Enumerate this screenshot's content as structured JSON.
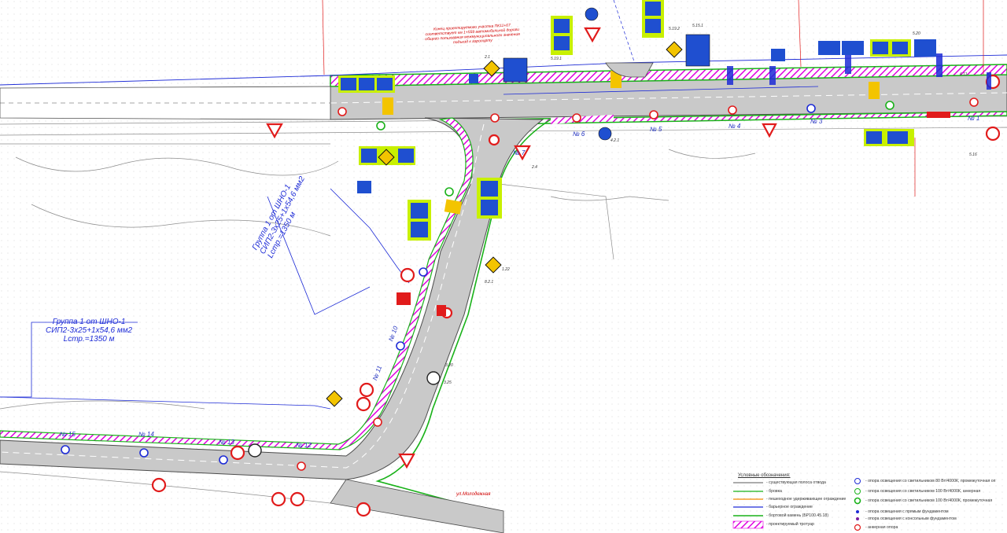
{
  "colors": {
    "road": "#c9c9c9",
    "road_edge": "#4c4c4c",
    "sidewalk_hatch": "#e000e0",
    "green_border": "#19b219",
    "sign_frame": "#c8f000",
    "sign_blue": "#1f4fd0",
    "warning_red": "#e11b1b",
    "cable_blue": "#1d2bd6",
    "marking_yellow": "#f3c400"
  },
  "cable_group_a": {
    "title": "Группа 1 от ШНО-1",
    "cable": "СИП2-3х25+1х54,6 мм2",
    "length": "Lстр.=1350 м"
  },
  "cable_group_b": {
    "title": "Группа 1 от ШНО-1",
    "cable": "СИП2-3х25+1х54,6 мм2",
    "length": "Lстр.=1350 м"
  },
  "note_top": {
    "line1": "Конец проектируемого участка ПК11+67",
    "line2": "соответствует км 1+559 автомобильной дороги",
    "line3": "общего пользования межмуниципального значения",
    "line4": "подъезд к аэропорту"
  },
  "street_name": "ул.Молодежная",
  "pole_numbers": [
    "№ 1",
    "№ 3",
    "№ 4",
    "№ 5",
    "№ 6",
    "№ 7",
    "№ 10",
    "№ 11",
    "№ 12",
    "№ 13",
    "№ 14",
    "№ 15"
  ],
  "sign_codes": [
    "5.19.1",
    "5.19.2",
    "5.15.1",
    "5.20",
    "2.1",
    "2.4",
    "1.22",
    "4.2.1",
    "8.2.1",
    "3.20",
    "3.25",
    "5.16",
    "6.11"
  ],
  "legend": {
    "title": "Условные обозначения:",
    "left_items": [
      "- существующая полоса отвода",
      "- бровка",
      "- пешеходное удерживающее ограждение",
      "- барьерное ограждение",
      "- бортовой камень (БР100.45.18)",
      "- проектируемый тротуар"
    ],
    "right_items": [
      "- опора освещения со светильником 80 Вт/4000К, промежуточная оп",
      "- опора освещения со светильником 100 Вт/4000К, анкерная",
      "- опора освещения со светильником 100 Вт/4000К, промежуточная",
      "- опора освещения с прямым фундаментом",
      "- опора освещения с консольным фундаментом",
      "- анкерная опора"
    ]
  }
}
